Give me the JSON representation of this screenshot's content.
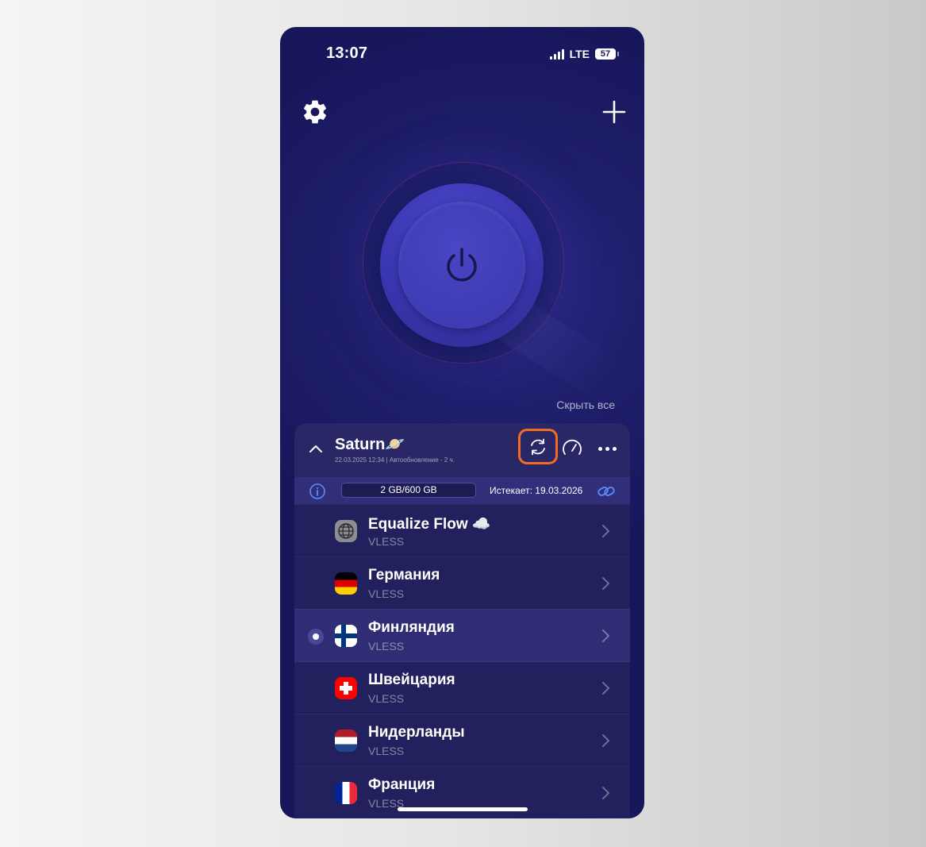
{
  "status": {
    "time": "13:07",
    "network": "LTE",
    "battery": "57"
  },
  "main": {
    "hide_all": "Скрыть все"
  },
  "subscription": {
    "name": "Saturn🪐",
    "meta": "22.03.2025 12:34  |  Автообновление - 2 ч.",
    "traffic": "2 GB/600 GB",
    "expires": "Истекает: 19.03.2026"
  },
  "servers": [
    {
      "name": "Equalize Flow ☁️",
      "protocol": "VLESS",
      "icon": "globe-icon",
      "selected": false
    },
    {
      "name": "Германия",
      "protocol": "VLESS",
      "icon": "flag-germany",
      "selected": false
    },
    {
      "name": "Финляндия",
      "protocol": "VLESS",
      "icon": "flag-finland",
      "selected": true
    },
    {
      "name": "Швейцария",
      "protocol": "VLESS",
      "icon": "flag-switzerland",
      "selected": false
    },
    {
      "name": "Нидерланды",
      "protocol": "VLESS",
      "icon": "flag-netherlands",
      "selected": false
    },
    {
      "name": "Франция",
      "protocol": "VLESS",
      "icon": "flag-france",
      "selected": false
    }
  ],
  "colors": {
    "accent_highlight": "#f26c21",
    "background": "#1f1e6b",
    "panel": "#22205d"
  }
}
